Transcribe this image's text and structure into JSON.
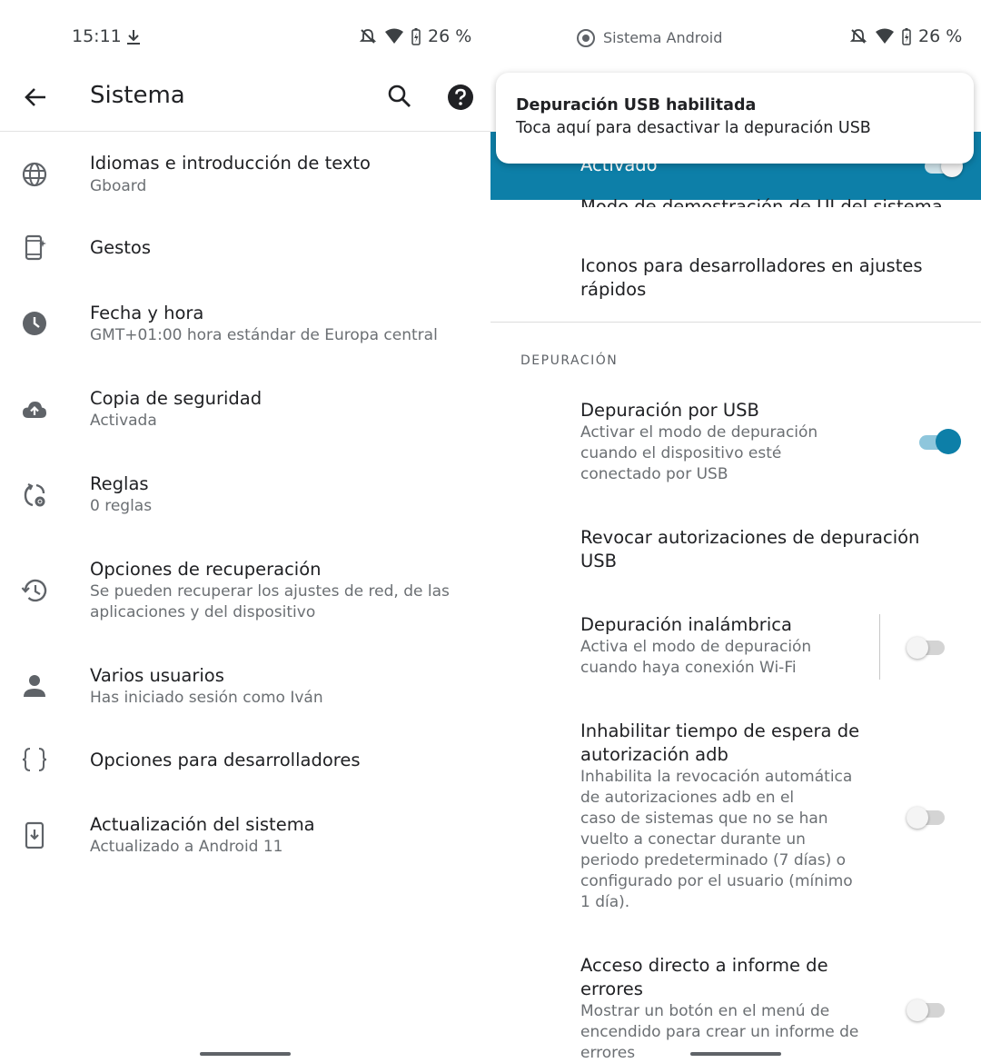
{
  "left": {
    "status": {
      "time": "15:11",
      "battery": "26 %"
    },
    "appbar": {
      "title": "Sistema"
    },
    "items": [
      {
        "title": "Idiomas e introducción de texto",
        "subtitle": "Gboard",
        "icon": "globe-icon"
      },
      {
        "title": "Gestos",
        "icon": "gestures-phone-icon"
      },
      {
        "title": "Fecha y hora",
        "subtitle": "GMT+01:00 hora estándar de Europa central",
        "icon": "clock-icon"
      },
      {
        "title": "Copia de seguridad",
        "subtitle": "Activada",
        "icon": "cloud-upload-icon"
      },
      {
        "title": "Reglas",
        "subtitle": "0 reglas",
        "icon": "rules-icon"
      },
      {
        "title": "Opciones de recuperación",
        "subtitle_lines": [
          "Se pueden recuperar los ajustes de red, de las",
          "aplicaciones y del dispositivo"
        ],
        "icon": "history-icon"
      },
      {
        "title": "Varios usuarios",
        "subtitle": "Has iniciado sesión como Iván",
        "icon": "person-icon"
      },
      {
        "title": "Opciones para desarrolladores",
        "icon": "braces-icon"
      },
      {
        "title": "Actualización del sistema",
        "subtitle": "Actualizado a Android 11",
        "icon": "system-update-icon"
      }
    ]
  },
  "right": {
    "status": {
      "app": "Sistema Android",
      "battery": "26 %"
    },
    "notification": {
      "title": "Depuración USB habilitada",
      "text": "Toca aquí para desactivar la depuración USB"
    },
    "activated_label": "Activado",
    "ui_demo_label": "Modo de demostración de UI del sistema",
    "quick_settings": {
      "lines": [
        "Iconos para desarrolladores en ajustes",
        "rápidos"
      ]
    },
    "section_header": "DEPURACIÓN",
    "usb_debugging": {
      "title": "Depuración por USB",
      "sub_lines": [
        "Activar el modo de depuración",
        "cuando el dispositivo esté",
        "conectado por USB"
      ],
      "enabled": true
    },
    "revoke": {
      "lines": [
        "Revocar autorizaciones de depuración",
        "USB"
      ]
    },
    "wireless": {
      "title": "Depuración inalámbrica",
      "sub_lines": [
        "Activa el modo de depuración",
        "cuando haya conexión Wi-Fi"
      ],
      "enabled": false
    },
    "adb_timeout": {
      "title_lines": [
        "Inhabilitar tiempo de espera de",
        "autorización adb"
      ],
      "sub_lines": [
        "Inhabilita la revocación automática",
        "de autorizaciones adb en el",
        "caso de sistemas que no se han",
        "vuelto a conectar durante un",
        "periodo predeterminado (7 días) o",
        "configurado por el usuario (mínimo",
        "1 día)."
      ],
      "enabled": false
    },
    "bug_report": {
      "title_lines": [
        "Acceso directo a informe de",
        "errores"
      ],
      "sub_lines": [
        "Mostrar un botón en el menú de",
        "encendido para crear un informe de",
        "errores"
      ],
      "enabled": false
    }
  }
}
